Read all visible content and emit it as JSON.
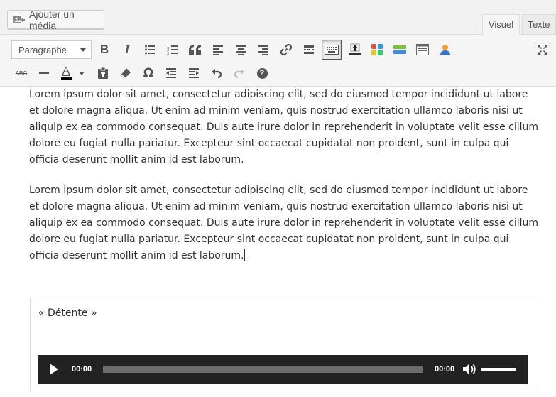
{
  "media_button": {
    "label": "Ajouter un média",
    "icon": "add-media-icon"
  },
  "tabs": [
    {
      "label": "Visuel",
      "active": true
    },
    {
      "label": "Texte",
      "active": false
    }
  ],
  "toolbar": {
    "format_select": {
      "selected": "Paragraphe"
    },
    "row1_icons": [
      "bold-icon",
      "italic-icon",
      "bullet-list-icon",
      "numbered-list-icon",
      "blockquote-icon",
      "align-left-icon",
      "align-center-icon",
      "align-right-icon",
      "link-icon",
      "read-more-icon",
      "toolbar-toggle-icon",
      "plugin-upload-icon",
      "plugin-grid-icon",
      "plugin-bar-icon",
      "plugin-table-icon",
      "plugin-user-icon",
      "fullscreen-icon"
    ],
    "row2_icons": [
      "strikethrough-icon",
      "horizontal-line-icon",
      "text-color-icon",
      "paste-text-icon",
      "clear-formatting-icon",
      "special-character-icon",
      "outdent-icon",
      "indent-icon",
      "undo-icon",
      "redo-icon",
      "help-icon"
    ],
    "strikethrough_label": "ABC",
    "text_color_label": "A",
    "omega_label": "Ω",
    "bold_label": "B",
    "italic_label": "I",
    "help_label": "?",
    "accent_color": "#555555"
  },
  "content": {
    "paragraphs": [
      "Lorem ipsum dolor sit amet, consectetur adipiscing elit, sed do eiusmod tempor incididunt ut labore et dolore magna aliqua. Ut enim ad minim veniam, quis nostrud exercitation ullamco laboris nisi ut aliquip ex ea commodo consequat. Duis aute irure dolor in reprehenderit in voluptate velit esse cillum dolore eu fugiat nulla pariatur. Excepteur sint occaecat cupidatat non proident, sunt in culpa qui officia deserunt mollit anim id est laborum.",
      "Lorem ipsum dolor sit amet, consectetur adipiscing elit, sed do eiusmod tempor incididunt ut labore et dolore magna aliqua. Ut enim ad minim veniam, quis nostrud exercitation ullamco laboris nisi ut aliquip ex ea commodo consequat. Duis aute irure dolor in reprehenderit in voluptate velit esse cillum dolore eu fugiat nulla pariatur. Excepteur sint occaecat cupidatat non proident, sunt in culpa qui officia deserunt mollit anim id est laborum."
    ]
  },
  "audio": {
    "title": "« Détente »",
    "current_time": "00:00",
    "duration": "00:00",
    "progress": 0,
    "volume": 1.0
  }
}
